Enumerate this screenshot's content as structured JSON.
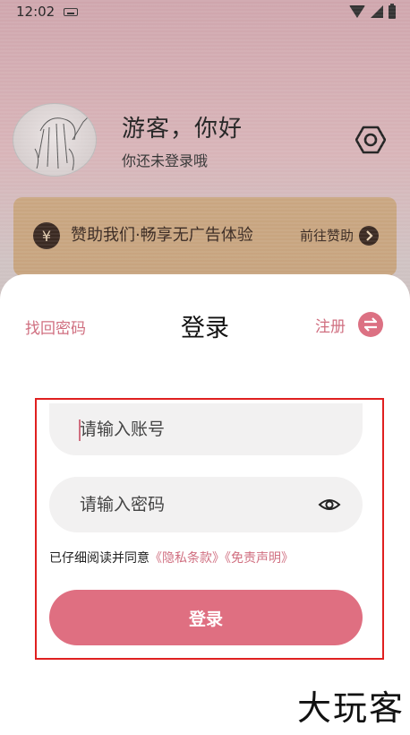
{
  "status_bar": {
    "time": "12:02",
    "icons": [
      "keyboard-icon",
      "wifi-icon",
      "signal-icon",
      "battery-icon"
    ]
  },
  "profile": {
    "greeting": "游客，你好",
    "subtitle": "你还未登录哦",
    "settings_icon": "gear-icon"
  },
  "sponsor": {
    "icon_symbol": "¥",
    "text": "赞助我们·畅享无广告体验",
    "link": "前往赞助"
  },
  "login_sheet": {
    "forgot_password": "找回密码",
    "title": "登录",
    "register": "注册",
    "account_placeholder": "请输入账号",
    "password_placeholder": "请输入密码",
    "agreement_prefix": "已仔细阅读并同意",
    "privacy_link": "《隐私条款》",
    "disclaimer_link": "《免责声明》",
    "login_button": "登录"
  },
  "colors": {
    "accent": "#df6f81",
    "link": "#d06f80",
    "highlight_border": "#e02020",
    "banner": "#c9a681"
  },
  "watermark": "大玩客"
}
